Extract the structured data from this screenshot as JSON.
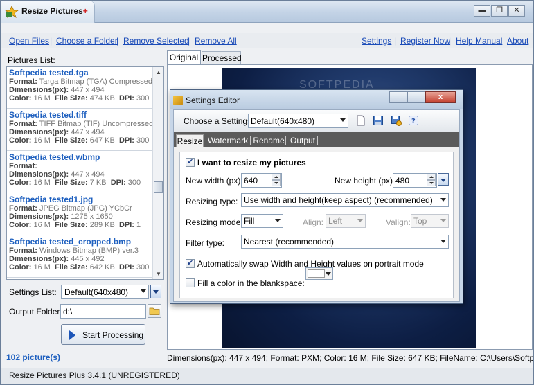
{
  "app": {
    "title": "Resize Pictures",
    "title_plus": "+",
    "window_buttons": {
      "minimize": "▬",
      "maximize": "❐",
      "close": "✕"
    }
  },
  "menu": {
    "left": [
      "Open Files",
      "Choose a Folder",
      "Remove Selected",
      "Remove All"
    ],
    "right": [
      "Settings",
      "Register Now",
      "Help Manual",
      "About"
    ],
    "separator": "|"
  },
  "pictures_list": {
    "label": "Pictures List:",
    "items": [
      {
        "name": "Softpedia tested.tga",
        "format": "Targa Bitmap (TGA) Compressed",
        "dimensions": "447 x 494",
        "color": "16 M",
        "file_size": "474 KB",
        "dpi": "300"
      },
      {
        "name": "Softpedia tested.tiff",
        "format": "TIFF Bitmap (TIF) Uncompressed",
        "dimensions": "447 x 494",
        "color": "16 M",
        "file_size": "647 KB",
        "dpi": "300"
      },
      {
        "name": "Softpedia tested.wbmp",
        "format": "",
        "dimensions": "447 x 494",
        "color": "16 M",
        "file_size": "7 KB",
        "dpi": "300"
      },
      {
        "name": "Softpedia tested1.jpg",
        "format": "JPEG Bitmap (JPG) YCbCr",
        "dimensions": "1275 x 1650",
        "color": "16 M",
        "file_size": "289 KB",
        "dpi": "1"
      },
      {
        "name": "Softpedia tested_cropped.bmp",
        "format": "Windows Bitmap (BMP) ver.3",
        "dimensions": "445 x 492",
        "color": "16 M",
        "file_size": "642 KB",
        "dpi": "300"
      }
    ],
    "field_labels": {
      "format": "Format:",
      "dimensions": "Dimensions(px):",
      "color": "Color:",
      "file_size": "File Size:",
      "dpi": "DPI:"
    }
  },
  "settings_list": {
    "label": "Settings List:",
    "value": "Default(640x480)"
  },
  "output_folder": {
    "label": "Output Folder:",
    "value": "d:\\"
  },
  "start_button": {
    "label": "Start Processing"
  },
  "status": {
    "count": "102 picture(s)",
    "version": "Resize Pictures Plus 3.4.1 (UNREGISTERED)",
    "details": "Dimensions(px): 447 x 494;  Format: PXM;  Color: 16 M;  File Size: 647 KB;  FileName: C:\\Users\\Softpedia\\Des"
  },
  "preview_tabs": [
    "Original",
    "Processed"
  ],
  "preview_watermark": "SOFTPEDIA",
  "dialog": {
    "title": "Settings Editor",
    "close_label": "x",
    "choose_label": "Choose a Settings:",
    "choose_value": "Default(640x480)",
    "toolbar_icons": [
      "new-file-icon",
      "save-icon",
      "save-as-icon",
      "help-icon"
    ],
    "tabs": [
      "Resize",
      "Watermark",
      "Rename",
      "Output"
    ],
    "active_tab": "Resize",
    "resize_checkbox": "I want to resize my pictures",
    "new_width_label": "New width (px):",
    "new_width": "640",
    "new_height_label": "New height (px):",
    "new_height": "480",
    "resizing_type_label": "Resizing type:",
    "resizing_type": "Use width and height(keep aspect) (recommended)",
    "resizing_mode_label": "Resizing mode:",
    "resizing_mode": "Fill",
    "align_label": "Align:",
    "align": "Left",
    "valign_label": "Valign:",
    "valign": "Top",
    "filter_type_label": "Filter type:",
    "filter_type": "Nearest (recommended)",
    "swap_label": "Automatically swap Width and Height values on portrait mode",
    "fill_color_label": "Fill a color in the blankspace:",
    "fill_color": "#ffffff",
    "resize_checked": true,
    "swap_checked": true,
    "fill_checked": false
  }
}
